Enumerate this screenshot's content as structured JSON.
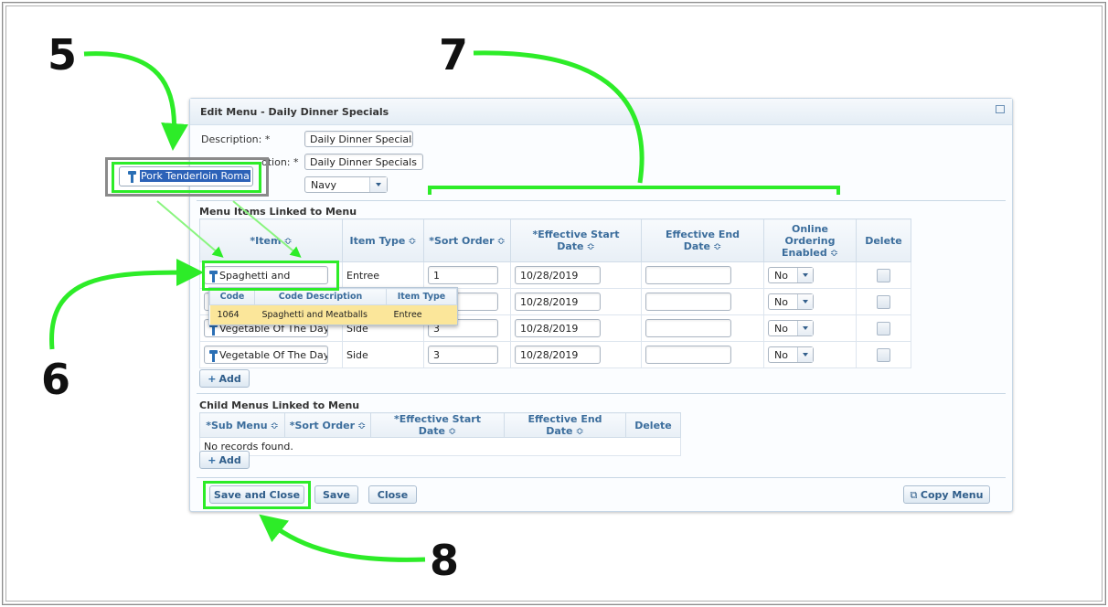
{
  "dialog": {
    "title": "Edit Menu - Daily Dinner Specials",
    "description_label": "Description: *",
    "description_value": "Daily Dinner Specials",
    "description2_label": "otion: *",
    "description2_value": "Daily Dinner Specials",
    "color_value": "Navy"
  },
  "floating_item": {
    "value": "Pork Tenderloin Roma"
  },
  "menu_items": {
    "section_title": "Menu Items Linked to Menu",
    "headers": {
      "item": "*Item",
      "item_type": "Item Type",
      "sort_order": "*Sort Order",
      "start": "*Effective Start Date",
      "end": "Effective End Date",
      "online_1": "Online",
      "online_2": "Ordering",
      "online_3": "Enabled",
      "delete": "Delete"
    },
    "sort_icon": "≎",
    "rows": [
      {
        "item": "Spaghetti and",
        "type": "Entree",
        "sort": "1",
        "start": "10/28/2019",
        "end": "",
        "online": "No"
      },
      {
        "item": "",
        "type": "",
        "sort": "",
        "start": "10/28/2019",
        "end": "",
        "online": "No"
      },
      {
        "item": "Vegetable Of The Day",
        "type": "Side",
        "sort": "3",
        "start": "10/28/2019",
        "end": "",
        "online": "No"
      },
      {
        "item": "Vegetable Of The Day",
        "type": "Side",
        "sort": "3",
        "start": "10/28/2019",
        "end": "",
        "online": "No"
      }
    ],
    "add_label": "Add"
  },
  "autocomplete": {
    "headers": {
      "code": "Code",
      "desc": "Code Description",
      "type": "Item Type"
    },
    "row": {
      "code": "1064",
      "desc": "Spaghetti and Meatballs",
      "type": "Entree"
    }
  },
  "child_menus": {
    "section_title": "Child Menus Linked to Menu",
    "headers": {
      "sub_menu": "*Sub Menu",
      "sort_order": "*Sort Order",
      "start": "*Effective Start Date",
      "end": "Effective End Date",
      "delete": "Delete"
    },
    "empty": "No records found.",
    "add_label": "Add"
  },
  "footer": {
    "save_close": "Save and Close",
    "save": "Save",
    "close": "Close",
    "copy_menu": "Copy Menu"
  },
  "annotations": {
    "n5": "5",
    "n6": "6",
    "n7": "7",
    "n8": "8"
  },
  "colors": {
    "highlight": "#2dec28",
    "header_text": "#3b6d9c",
    "selection": "#fbe69a"
  }
}
